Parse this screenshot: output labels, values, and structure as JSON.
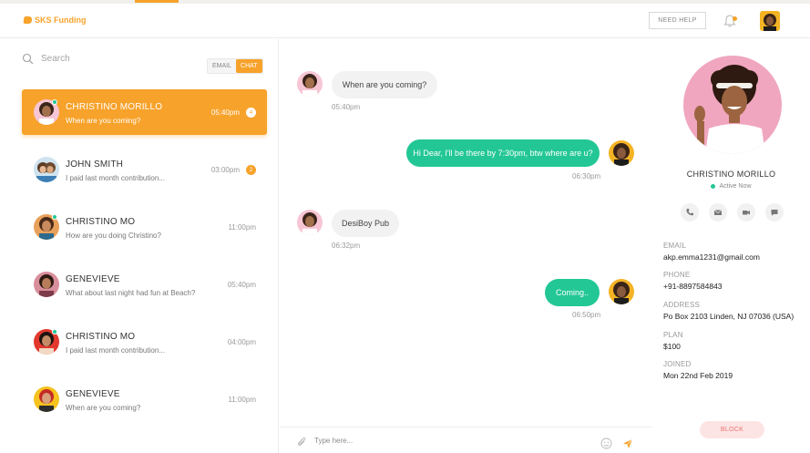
{
  "brand": {
    "name": "SKS Funding",
    "accent": "#f7a22b",
    "green": "#23c795"
  },
  "header": {
    "help_label": "NEED HELP",
    "bell_icon": "bell-icon"
  },
  "sidebar": {
    "search_placeholder": "Search",
    "toggle": {
      "email": "EMAIL",
      "chat": "CHAT"
    },
    "contacts": [
      {
        "name": "CHRISTINO MORILLO",
        "message": "When are you coming?",
        "time": "05:40pm",
        "badge": "4",
        "active": true
      },
      {
        "name": "JOHN SMITH",
        "message": "I paid last month contribution...",
        "time": "03:00pm",
        "badge": "2"
      },
      {
        "name": "CHRISTINO MO",
        "message": "How are you doing Christino?",
        "time": "11:00pm"
      },
      {
        "name": "GENEVIEVE",
        "message": "What about last night had fun at Beach?",
        "time": "05:40pm"
      },
      {
        "name": "CHRISTINO MO",
        "message": "I paid last month contribution...",
        "time": "04:00pm"
      },
      {
        "name": "GENEVIEVE",
        "message": "When are you coming?",
        "time": "11:00pm"
      }
    ]
  },
  "chat": {
    "messages": [
      {
        "direction": "in",
        "text": "When are you coming?",
        "time": "05:40pm"
      },
      {
        "direction": "out",
        "text": "Hi Dear, I'll be there by 7:30pm, btw where are u?",
        "time": "06:30pm"
      },
      {
        "direction": "in",
        "text": "DesiBoy Pub",
        "time": "06:32pm"
      },
      {
        "direction": "out",
        "text": "Coming..",
        "time": "06:50pm"
      }
    ],
    "compose_placeholder": "Type here..."
  },
  "profile": {
    "name": "CHRISTINO MORILLO",
    "status": "Active Now",
    "fields": [
      {
        "label": "EMAIL",
        "value": "akp.emma1231@gmail.com"
      },
      {
        "label": "PHONE",
        "value": "+91-8897584843"
      },
      {
        "label": "ADDRESS",
        "value": "Po Box 2103 Linden, NJ 07036 (USA)"
      },
      {
        "label": "PLAN",
        "value": "$100"
      },
      {
        "label": "JOINED",
        "value": "Mon 22nd Feb 2019"
      }
    ],
    "block_label": "BLOCK"
  }
}
